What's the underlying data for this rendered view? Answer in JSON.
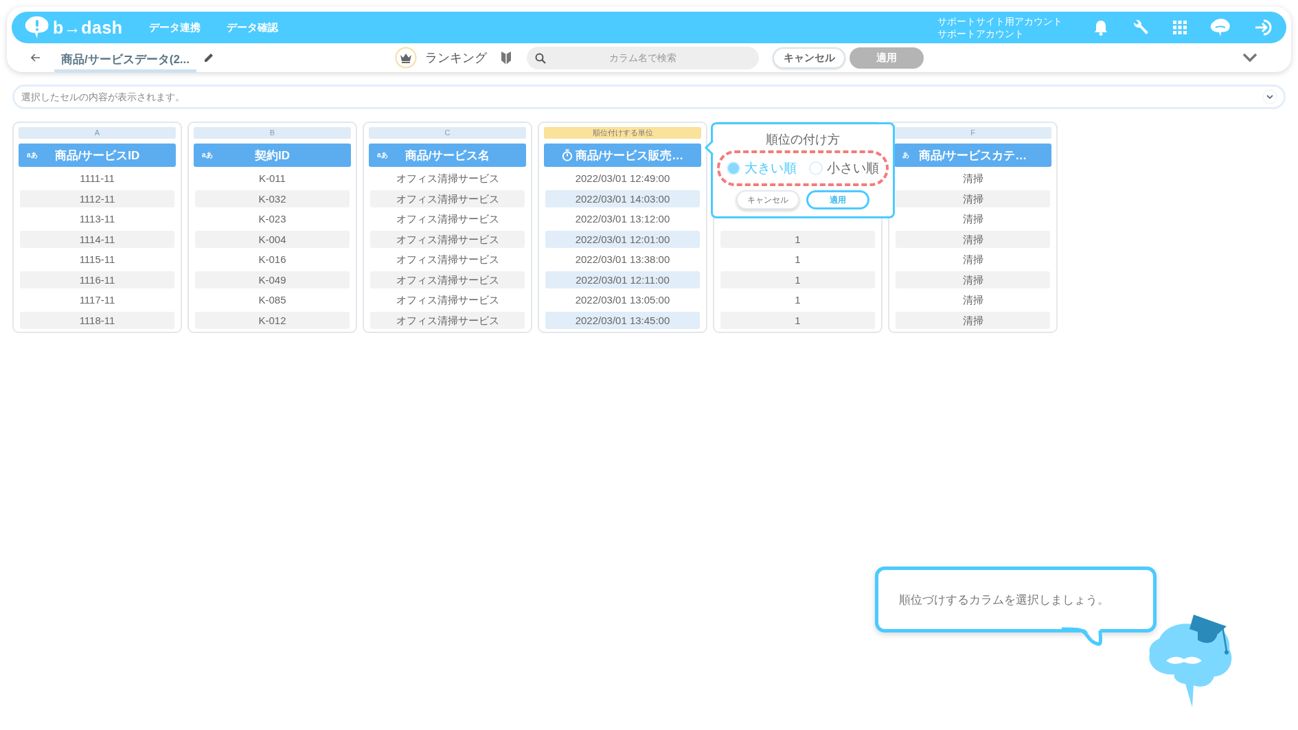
{
  "header": {
    "logo": "b→dash",
    "nav": [
      {
        "label": "データ連携"
      },
      {
        "label": "データ確認"
      }
    ],
    "account": {
      "site": "サポートサイト用アカウント",
      "name": "サポートアカウント"
    }
  },
  "toolbar": {
    "title": "商品/サービスデータ(2...",
    "mode": "ランキング",
    "search": {
      "placeholder": "カラム名で検索"
    },
    "buttons": [
      {
        "label": "キャンセル",
        "disabled": false
      },
      {
        "label": "適用",
        "disabled": true
      }
    ]
  },
  "cell_bar": {
    "placeholder": "選択したセルの内容が表示されます。"
  },
  "columns": [
    {
      "letter": "A",
      "kind": "text",
      "type_label": "aあ",
      "header": "商品/サービスID",
      "selected": false,
      "cells": [
        "1111-11",
        "1112-11",
        "1113-11",
        "1114-11",
        "1115-11",
        "1116-11",
        "1117-11",
        "1118-11"
      ]
    },
    {
      "letter": "B",
      "kind": "text",
      "type_label": "aあ",
      "header": "契約ID",
      "selected": false,
      "cells": [
        "K-011",
        "K-032",
        "K-023",
        "K-004",
        "K-016",
        "K-049",
        "K-085",
        "K-012"
      ]
    },
    {
      "letter": "C",
      "kind": "text",
      "type_label": "aあ",
      "header": "商品/サービス名",
      "selected": false,
      "cells": [
        "オフィス清掃サービス",
        "オフィス清掃サービス",
        "オフィス清掃サービス",
        "オフィス清掃サービス",
        "オフィス清掃サービス",
        "オフィス清掃サービス",
        "オフィス清掃サービス",
        "オフィス清掃サービス"
      ]
    },
    {
      "ranking_label": "順位付けする単位",
      "kind": "datetime",
      "header": "商品/サービス販売…",
      "selected": true,
      "cells": [
        "2022/03/01 12:49:00",
        "2022/03/01 14:03:00",
        "2022/03/01 13:12:00",
        "2022/03/01 12:01:00",
        "2022/03/01 13:38:00",
        "2022/03/01 12:11:00",
        "2022/03/01 13:05:00",
        "2022/03/01 13:45:00"
      ]
    },
    {
      "selected": false,
      "cells": [
        "1",
        "1",
        "1",
        "1",
        "1"
      ]
    },
    {
      "letter": "F",
      "kind": "text",
      "type_label": "あ",
      "header": "商品/サービスカテ…",
      "selected": false,
      "cells": [
        "清掃",
        "清掃",
        "清掃",
        "清掃",
        "清掃",
        "清掃",
        "清掃",
        "清掃"
      ]
    }
  ],
  "popover": {
    "title": "順位の付け方",
    "options": [
      {
        "label": "大きい順",
        "selected": true
      },
      {
        "label": "小さい順",
        "selected": false
      }
    ],
    "buttons": [
      {
        "label": "キャンセル",
        "primary": false
      },
      {
        "label": "適用",
        "primary": true
      }
    ]
  },
  "guide": {
    "message": "順位づけするカラムを選択しましょう。"
  }
}
